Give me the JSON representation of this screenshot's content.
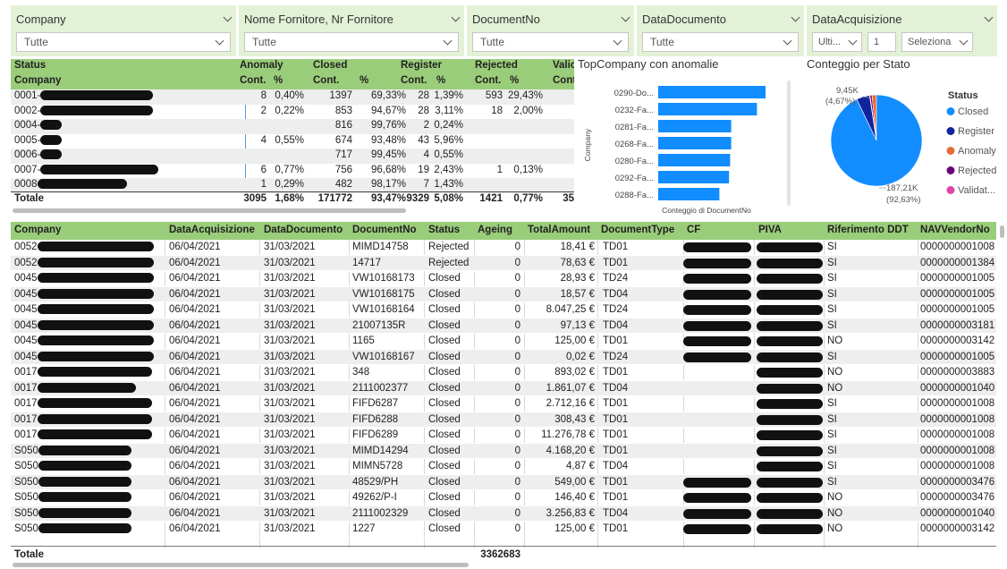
{
  "slicers": [
    {
      "label": "Company",
      "value": "Tutte"
    },
    {
      "label": "Nome Fornitore, Nr Fornitore",
      "value": "Tutte"
    },
    {
      "label": "DocumentNo",
      "value": "Tutte"
    },
    {
      "label": "DataDocumento",
      "value": "Tutte"
    },
    {
      "label": "DataAcquisizione",
      "period": "Ulti...",
      "count": "1",
      "unit": "Seleziona"
    }
  ],
  "matrix": {
    "status_label": "Status",
    "company_label": "Company",
    "groups": [
      "Anomaly",
      "Closed",
      "Register",
      "Rejected",
      "Valic"
    ],
    "sub": [
      "Cont.",
      "%",
      "Cont.",
      "%",
      "Cont.",
      "%",
      "Cont.",
      "%",
      "Cont"
    ],
    "rows": [
      {
        "c": "0001-",
        "a": [
          "8",
          "0,40%",
          "1397",
          "69,33%",
          "28",
          "1,39%",
          "593",
          "29,43%"
        ]
      },
      {
        "c": "0002-",
        "a": [
          "2",
          "0,22%",
          "853",
          "94,67%",
          "28",
          "3,11%",
          "18",
          "2,00%"
        ]
      },
      {
        "c": "0004-",
        "a": [
          "",
          "",
          "816",
          "99,76%",
          "2",
          "0,24%",
          "",
          ""
        ]
      },
      {
        "c": "0005-",
        "a": [
          "4",
          "0,55%",
          "674",
          "93,48%",
          "43",
          "5,96%",
          "",
          ""
        ]
      },
      {
        "c": "0006-",
        "a": [
          "",
          "",
          "717",
          "99,45%",
          "4",
          "0,55%",
          "",
          ""
        ]
      },
      {
        "c": "0007-",
        "a": [
          "6",
          "0,77%",
          "756",
          "96,68%",
          "19",
          "2,43%",
          "1",
          "0,13%"
        ]
      },
      {
        "c": "0008",
        "a": [
          "1",
          "0,29%",
          "482",
          "98,17%",
          "7",
          "1,43%",
          "",
          ""
        ]
      }
    ],
    "total": {
      "label": "Totale",
      "a": [
        "3095",
        "1,68%",
        "171772",
        "93,47%",
        "9329",
        "5,08%",
        "1421",
        "0,77%",
        "35"
      ]
    }
  },
  "chart_data": [
    {
      "type": "bar",
      "title": "TopCompany con anomalie",
      "xlabel": "Conteggio di DocumentNo",
      "ylabel": "Company",
      "categories": [
        "0290-Do...",
        "0232-Fa...",
        "0281-Fa...",
        "0268-Fa...",
        "0280-Fa...",
        "0292-Fa...",
        "0288-Fa..."
      ],
      "values": [
        100,
        92,
        68,
        68,
        67,
        66,
        57
      ],
      "color": "#118dff"
    },
    {
      "type": "pie",
      "title": "Conteggio per Stato",
      "legend_title": "Status",
      "slices": [
        {
          "name": "Closed",
          "value": 187210,
          "label": "187,21K",
          "pct": "(92,63%)",
          "color": "#118dff"
        },
        {
          "name": "Register",
          "value": 9450,
          "label": "9,45K",
          "pct": "(4,67%)",
          "color": "#12239e"
        },
        {
          "name": "Anomaly",
          "value": 3095,
          "color": "#e66c37"
        },
        {
          "name": "Rejected",
          "value": 1421,
          "color": "#6b007b"
        },
        {
          "name": "Validat...",
          "value": 350,
          "color": "#e044a7"
        }
      ]
    }
  ],
  "grid": {
    "columns": [
      "Company",
      "DataAcquisizione",
      "DataDocumento",
      "DocumentNo",
      "Status",
      "Ageing",
      "TotalAmount",
      "DocumentType",
      "CF",
      "PIVA",
      "Riferimento DDT",
      "NAVVendorNo"
    ],
    "rows": [
      [
        "0052",
        "06/04/2021",
        "31/03/2021",
        "MIMD14758",
        "Rejected",
        "0",
        "18,41 €",
        "TD01",
        "",
        "",
        "SI",
        "0000000001008"
      ],
      [
        "0052",
        "06/04/2021",
        "31/03/2021",
        "14717",
        "Rejected",
        "0",
        "78,63 €",
        "TD01",
        "",
        "",
        "SI",
        "0000000001384"
      ],
      [
        "0045",
        "06/04/2021",
        "31/03/2021",
        "VW10168173",
        "Closed",
        "0",
        "28,93 €",
        "TD24",
        "",
        "",
        "SI",
        "0000000001005"
      ],
      [
        "0045",
        "06/04/2021",
        "31/03/2021",
        "VW10168175",
        "Closed",
        "0",
        "18,57 €",
        "TD04",
        "",
        "",
        "SI",
        "0000000001005"
      ],
      [
        "0045",
        "06/04/2021",
        "31/03/2021",
        "VW10168164",
        "Closed",
        "0",
        "8.047,25 €",
        "TD24",
        "",
        "",
        "SI",
        "0000000001005"
      ],
      [
        "0045",
        "06/04/2021",
        "31/03/2021",
        "21007135R",
        "Closed",
        "0",
        "97,13 €",
        "TD04",
        "",
        "",
        "SI",
        "0000000003181"
      ],
      [
        "0045",
        "06/04/2021",
        "31/03/2021",
        "1165",
        "Closed",
        "0",
        "125,00 €",
        "TD01",
        "",
        "",
        "NO",
        "0000000003142"
      ],
      [
        "0045",
        "06/04/2021",
        "31/03/2021",
        "VW10168167",
        "Closed",
        "0",
        "0,02 €",
        "TD24",
        "",
        "",
        "SI",
        "0000000001005"
      ],
      [
        "0017",
        "06/04/2021",
        "31/03/2021",
        "348",
        "Closed",
        "0",
        "893,02 €",
        "TD01",
        "",
        "",
        "NO",
        "0000000003883"
      ],
      [
        "0017",
        "06/04/2021",
        "31/03/2021",
        "2111002377",
        "Closed",
        "0",
        "1.861,07 €",
        "TD04",
        "",
        "",
        "NO",
        "0000000001040"
      ],
      [
        "0017",
        "06/04/2021",
        "31/03/2021",
        "FIFD6287",
        "Closed",
        "0",
        "2.712,16 €",
        "TD01",
        "",
        "",
        "SI",
        "0000000001008"
      ],
      [
        "0017",
        "06/04/2021",
        "31/03/2021",
        "FIFD6288",
        "Closed",
        "0",
        "308,43 €",
        "TD01",
        "",
        "",
        "SI",
        "0000000001008"
      ],
      [
        "0017",
        "06/04/2021",
        "31/03/2021",
        "FIFD6289",
        "Closed",
        "0",
        "11.276,78 €",
        "TD01",
        "",
        "",
        "SI",
        "0000000001008"
      ],
      [
        "S050",
        "06/04/2021",
        "31/03/2021",
        "MIMD14294",
        "Closed",
        "0",
        "4.168,20 €",
        "TD01",
        "",
        "",
        "SI",
        "0000000001008"
      ],
      [
        "S050",
        "06/04/2021",
        "31/03/2021",
        "MIMN5728",
        "Closed",
        "0",
        "4,87 €",
        "TD04",
        "",
        "",
        "SI",
        "0000000001008"
      ],
      [
        "S050",
        "06/04/2021",
        "31/03/2021",
        "48529/PH",
        "Closed",
        "0",
        "549,00 €",
        "TD01",
        "",
        "",
        "SI",
        "0000000003476"
      ],
      [
        "S050",
        "06/04/2021",
        "31/03/2021",
        "49262/P-I",
        "Closed",
        "0",
        "146,40 €",
        "TD01",
        "",
        "",
        "NO",
        "0000000003476"
      ],
      [
        "S050",
        "06/04/2021",
        "31/03/2021",
        "2111002329",
        "Closed",
        "0",
        "3.256,83 €",
        "TD04",
        "",
        "",
        "NO",
        "0000000001040"
      ],
      [
        "S050",
        "06/04/2021",
        "31/03/2021",
        "1227",
        "Closed",
        "0",
        "125,00 €",
        "TD01",
        "",
        "",
        "NO",
        "0000000003142"
      ]
    ],
    "total_label": "Totale",
    "total_ageing": "3362683"
  }
}
